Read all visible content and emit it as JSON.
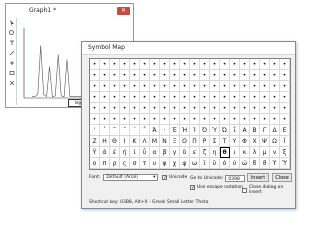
{
  "graph_window": {
    "title": "Graph1 *",
    "close_label": "✕",
    "legend_label": "legend2"
  },
  "symbol_map": {
    "title": "Symbol Map",
    "symbols": [
      "•",
      "•",
      "•",
      "•",
      "•",
      "•",
      "•",
      "•",
      "•",
      "•",
      "•",
      "•",
      "•",
      "•",
      "•",
      "•",
      "•",
      "•",
      "•",
      "•",
      "•",
      "•",
      "•",
      "•",
      "•",
      "•",
      "•",
      "•",
      "•",
      "•",
      "•",
      "•",
      "•",
      "•",
      "•",
      "•",
      "•",
      "•",
      "•",
      "•",
      "•",
      "•",
      "•",
      "•",
      "•",
      "•",
      "•",
      "•",
      "•",
      "•",
      "•",
      "•",
      "•",
      "•",
      "•",
      "•",
      "•",
      "•",
      "•",
      "•",
      "•",
      "•",
      "•",
      "•",
      "•",
      "•",
      "•",
      "•",
      "•",
      "•",
      "•",
      "•",
      "•",
      "•",
      "•",
      "•",
      "•",
      "•",
      "•",
      "•",
      "•",
      "•",
      "•",
      "•",
      "•",
      "•",
      "•",
      "•",
      "•",
      "•",
      "•",
      "•",
      "•",
      "•",
      "•",
      "•",
      "•",
      "•",
      "•",
      "•",
      "•",
      "•",
      "•",
      "•",
      "•",
      "•",
      "•",
      "•",
      "•",
      "•",
      "•",
      "•",
      "•",
      "•",
      "•",
      "•",
      "•",
      "•",
      "•",
      "•",
      "ʼ",
      "ʽ",
      "˜",
      "˝",
      "΄",
      "΅",
      "Ά",
      "·",
      "Έ",
      "Ή",
      "Ί",
      "Ό",
      "Ύ",
      "Ώ",
      "ΐ",
      "Α",
      "Β",
      "Γ",
      "Δ",
      "Ε",
      "Ζ",
      "Η",
      "Θ",
      "Ι",
      "Κ",
      "Λ",
      "Μ",
      "Ν",
      "Ξ",
      "Ο",
      "Π",
      "Ρ",
      "Σ",
      "Τ",
      "Υ",
      "Φ",
      "Χ",
      "Ψ",
      "Ω",
      "Ϊ",
      "Ϋ",
      "ά",
      "έ",
      "ή",
      "ί",
      "ΰ",
      "α",
      "β",
      "γ",
      "δ",
      "ε",
      "ζ",
      "η",
      "θ",
      "ι",
      "κ",
      "λ",
      "μ",
      "ν",
      "ξ",
      "ο",
      "π",
      "ρ",
      "ς",
      "σ",
      "τ",
      "υ",
      "φ",
      "χ",
      "ψ",
      "ω",
      "ϊ",
      "ϋ",
      "ό",
      "ύ",
      "ώ",
      "ϐ",
      "ϑ",
      "ϒ",
      "ϓ"
    ],
    "selected_index": 173,
    "font_label": "Font:",
    "font_value": "Default (Arial)",
    "unicode_label": "Unicode",
    "unicode_checked": true,
    "goto_label": "Go to Unicode:",
    "goto_value": "0398",
    "insert_label": "Insert",
    "close_label": "Close",
    "escape_label": "Use escape notation",
    "escape_checked": true,
    "close_on_insert_label": "Close dialog on insert",
    "close_on_insert_checked": false,
    "status_text": "Shortcut key: 03B8, Alt+X  -  Greek Small Letter Theta",
    "selected_color": "#000000"
  },
  "chart_data": {
    "type": "line",
    "title": "",
    "xlabel": "",
    "ylabel": "",
    "ylim": [
      0,
      1
    ],
    "series": [
      {
        "x": [
          0,
          1,
          2,
          3,
          4,
          5,
          6,
          7,
          8,
          9,
          10,
          11,
          12,
          13,
          14,
          15,
          16,
          17,
          18,
          19,
          20
        ],
        "values": [
          0.02,
          0.02,
          0.05,
          0.75,
          0.05,
          0.02,
          0.45,
          0.02,
          0.03,
          0.62,
          0.03,
          0.02,
          0.55,
          0.02,
          0.02,
          0.02,
          0.02,
          0.02,
          0.02,
          0.02,
          0.02
        ]
      }
    ]
  }
}
